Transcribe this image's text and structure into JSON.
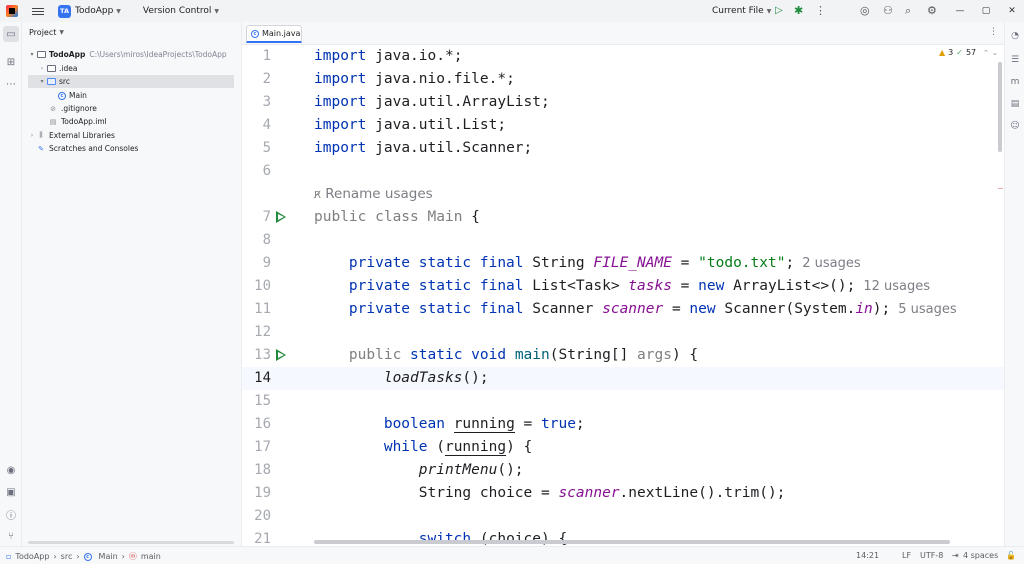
{
  "titlebar": {
    "project_badge": "TA",
    "project_name": "TodoApp",
    "vcs_label": "Version Control",
    "run_config": "Current File"
  },
  "project_panel": {
    "title": "Project",
    "tree": [
      {
        "label": "TodoApp",
        "path": "C:\\Users\\miros\\IdeaProjects\\TodoApp"
      },
      {
        "label": ".idea"
      },
      {
        "label": "src"
      },
      {
        "label": "Main"
      },
      {
        "label": ".gitignore"
      },
      {
        "label": "TodoApp.iml"
      },
      {
        "label": "External Libraries"
      },
      {
        "label": "Scratches and Consoles"
      }
    ]
  },
  "editor": {
    "tab_label": "Main.java",
    "inspections": {
      "warnings": "3",
      "ok": "57"
    },
    "lines": [
      "1",
      "2",
      "3",
      "4",
      "5",
      "6",
      "7",
      "8",
      "9",
      "10",
      "11",
      "12",
      "13",
      "14",
      "15",
      "16",
      "17",
      "18",
      "19",
      "20",
      "21"
    ],
    "rename_hint": "Rename usages",
    "usages": {
      "file_name": "2 usages",
      "tasks": "12 usages",
      "scanner": "5 usages"
    },
    "code": {
      "l1": "java.io.*;",
      "l2": "java.nio.file.*;",
      "l3": "java.util.ArrayList;",
      "l4": "java.util.List;",
      "l5": "java.util.Scanner;"
    }
  },
  "statusbar": {
    "crumbs": [
      "TodoApp",
      "src",
      "Main",
      "main"
    ],
    "position": "14:21",
    "line_ending": "LF",
    "encoding": "UTF-8",
    "indent": "4 spaces"
  }
}
